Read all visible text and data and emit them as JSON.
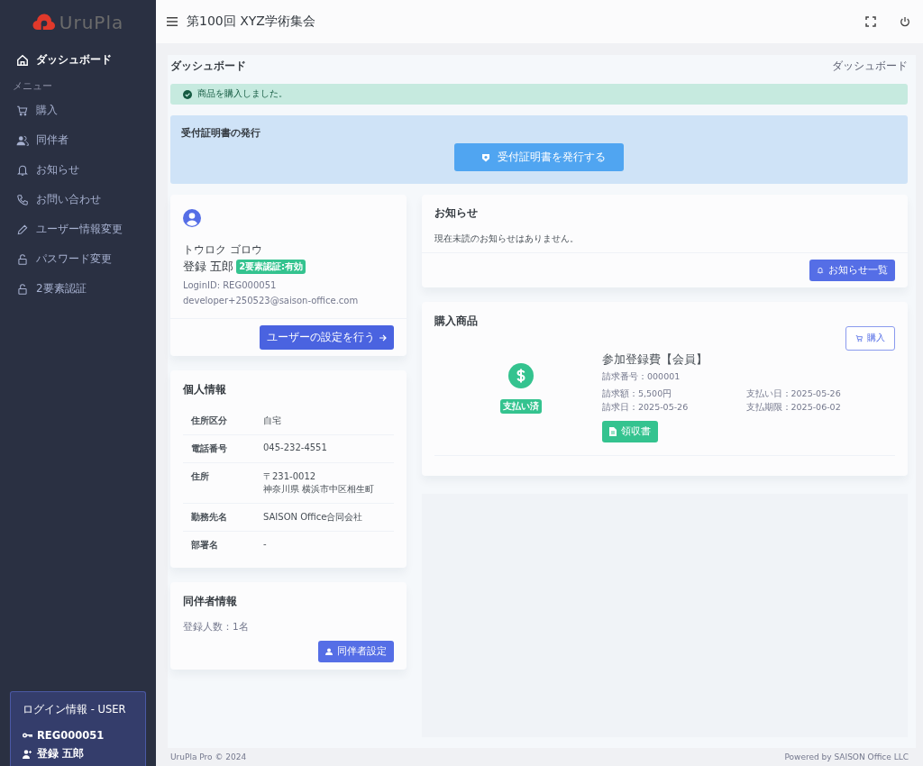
{
  "sidebar": {
    "logo": "UruPla",
    "top_items": [
      {
        "label": "ダッシュボード",
        "selected": true
      }
    ],
    "menu_heading": "メニュー",
    "items": [
      {
        "label": "購入",
        "selected": false
      },
      {
        "label": "同伴者",
        "selected": false
      },
      {
        "label": "お知らせ",
        "selected": false
      },
      {
        "label": "お問い合わせ",
        "selected": false
      },
      {
        "label": "ユーザー情報変更",
        "selected": false
      },
      {
        "label": "パスワード変更",
        "selected": false
      },
      {
        "label": "2要素認証",
        "selected": false
      }
    ]
  },
  "login_info": {
    "title": "ログイン情報 - USER",
    "login_id": "REG000051",
    "name": "登録 五郎"
  },
  "header": {
    "title": "第100回 XYZ学術集会"
  },
  "page": {
    "title": "ダッシュボード",
    "breadcrumb": "ダッシュボード"
  },
  "alert": {
    "message": "商品を購入しました。"
  },
  "certificate": {
    "title": "受付証明書の発行",
    "button": "受付証明書を発行する"
  },
  "profile": {
    "kana": "トウロク ゴロウ",
    "name": "登録 五郎",
    "badge": "2要素認証:有効",
    "login_id": "LoginID: REG000051",
    "email": "developer+250523@saison-office.com",
    "button": "ユーザーの設定を行う"
  },
  "personal_info": {
    "title": "個人情報",
    "rows": [
      {
        "label": "住所区分",
        "value": "自宅"
      },
      {
        "label": "電話番号",
        "value": "045-232-4551"
      },
      {
        "label": "住所",
        "value": "〒231-0012\n神奈川県 横浜市中区相生町"
      },
      {
        "label": "勤務先名",
        "value": "SAISON Office合同会社"
      },
      {
        "label": "部署名",
        "value": "-"
      }
    ]
  },
  "companions": {
    "title": "同伴者情報",
    "count": "登録人数：1名",
    "button": "同伴者設定"
  },
  "notices": {
    "title": "お知らせ",
    "message": "現在未読のお知らせはありません。",
    "button": "お知らせ一覧"
  },
  "purchases": {
    "title": "購入商品",
    "buy_button": "購入",
    "items": [
      {
        "name": "参加登録費【会員】",
        "status": "支払い済",
        "invoice_no": "請求番号：000001",
        "amount": "請求額：5,500円",
        "paid_date": "支払い日：2025-05-26",
        "invoice_date": "請求日：2025-05-26",
        "due_date": "支払期限：2025-06-02",
        "receipt_button": "領収書"
      }
    ]
  },
  "footer": {
    "left": "UruPla Pro © 2024",
    "right": "Powered by SAISON Office LLC"
  }
}
